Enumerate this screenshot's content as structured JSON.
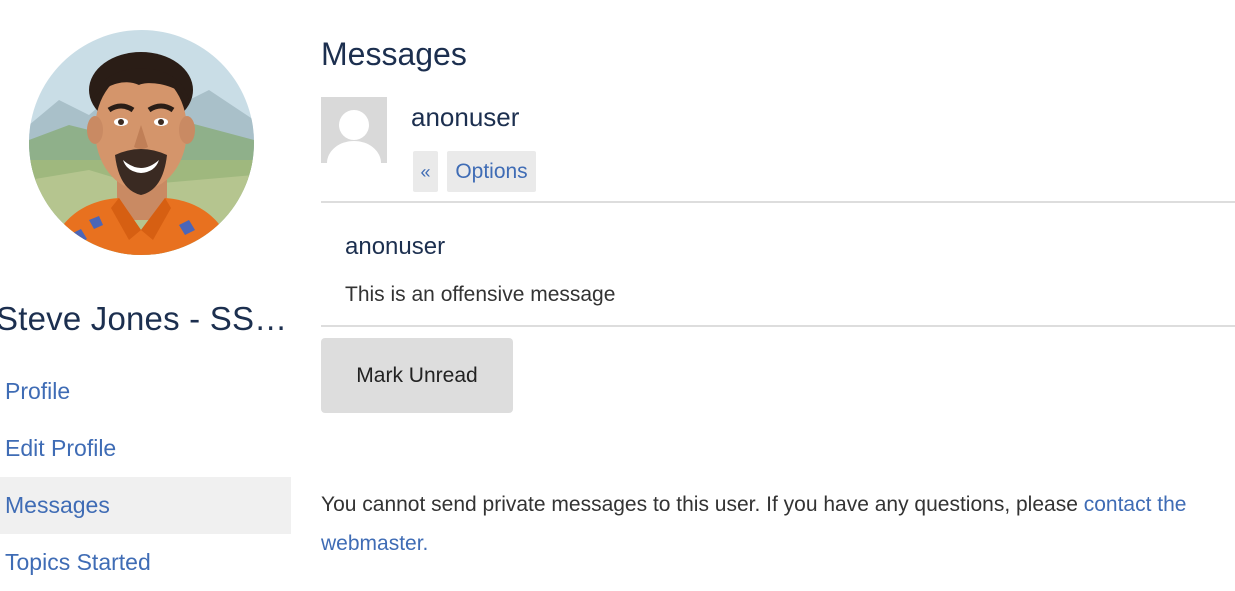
{
  "sidebar": {
    "user_name": "Steve Jones - SSC Editor",
    "nav": [
      {
        "label": "Profile",
        "active": false
      },
      {
        "label": "Edit Profile",
        "active": false
      },
      {
        "label": "Messages",
        "active": true
      },
      {
        "label": "Topics Started",
        "active": false
      }
    ]
  },
  "main": {
    "title": "Messages",
    "thread_user": "anonuser",
    "prev_label": "«",
    "options_label": "Options",
    "message": {
      "sender": "anonuser",
      "body": "This is an offensive message"
    },
    "mark_unread_label": "Mark Unread",
    "notice_text": "You cannot send private messages to this user. If you have any questions, please ",
    "notice_link": "contact the webmaster."
  },
  "colors": {
    "heading": "#1c2f4f",
    "link": "#3f6cb5",
    "button_bg": "#dddddd",
    "active_nav_bg": "#f0f0f0"
  }
}
